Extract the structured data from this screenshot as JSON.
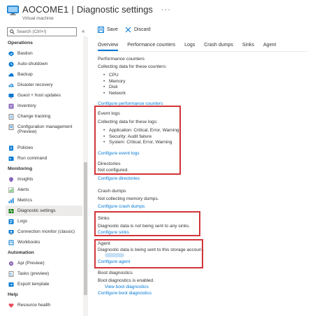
{
  "header": {
    "vm_name": "AOCOME1",
    "separator": "|",
    "title": "Diagnostic settings",
    "more": "···",
    "subtitle": "Virtual machine"
  },
  "sidebar": {
    "search_placeholder": "Search (Ctrl+/)",
    "collapse_glyph": "«",
    "sections": [
      {
        "label": "Operations",
        "items": [
          {
            "label": "Bastion",
            "icon": "bastion-icon"
          },
          {
            "label": "Auto-shutdown",
            "icon": "clock-icon"
          },
          {
            "label": "Backup",
            "icon": "backup-icon"
          },
          {
            "label": "Disaster recovery",
            "icon": "disaster-recovery-icon"
          },
          {
            "label": "Guest + host updates",
            "icon": "updates-icon"
          },
          {
            "label": "Inventory",
            "icon": "inventory-icon"
          },
          {
            "label": "Change tracking",
            "icon": "change-tracking-icon"
          },
          {
            "label": "Configuration management (Preview)",
            "icon": "config-management-icon"
          },
          {
            "label": "Policies",
            "icon": "policies-icon"
          },
          {
            "label": "Run command",
            "icon": "run-command-icon"
          }
        ]
      },
      {
        "label": "Monitoring",
        "items": [
          {
            "label": "Insights",
            "icon": "insights-icon"
          },
          {
            "label": "Alerts",
            "icon": "alerts-icon"
          },
          {
            "label": "Metrics",
            "icon": "metrics-icon"
          },
          {
            "label": "Diagnostic settings",
            "icon": "diagnostic-icon",
            "selected": true
          },
          {
            "label": "Logs",
            "icon": "logs-icon"
          },
          {
            "label": "Connection monitor (classic)",
            "icon": "connection-monitor-icon"
          },
          {
            "label": "Workbooks",
            "icon": "workbooks-icon"
          }
        ]
      },
      {
        "label": "Automation",
        "items": [
          {
            "label": "Api (Preview)",
            "icon": "api-icon"
          },
          {
            "label": "Tasks (preview)",
            "icon": "tasks-icon"
          },
          {
            "label": "Export template",
            "icon": "export-template-icon"
          }
        ]
      },
      {
        "label": "Help",
        "items": [
          {
            "label": "Resource health",
            "icon": "resource-health-icon"
          }
        ]
      }
    ]
  },
  "toolbar": {
    "save_label": "Save",
    "discard_label": "Discard"
  },
  "tabs": [
    "Overview",
    "Performance counters",
    "Logs",
    "Crash dumps",
    "Sinks",
    "Agent"
  ],
  "content": {
    "perf": {
      "heading": "Performance counters",
      "desc": "Collecting data for these counters:",
      "items": [
        "CPU",
        "Memory",
        "Disk",
        "Network"
      ],
      "link": "Configure performance counters"
    },
    "event_logs": {
      "heading": "Event logs",
      "desc": "Collecting data for these logs:",
      "items": [
        "Application: Critical, Error, Warning",
        "Security: Audit failure",
        "System: Critical, Error, Warning"
      ],
      "link": "Configure event logs"
    },
    "directories": {
      "heading": "Directories",
      "status": "Not configured.",
      "link": "Configure directories"
    },
    "crash": {
      "heading": "Crash dumps",
      "status": "Not collecting memory dumps.",
      "link": "Configure crash dumps"
    },
    "sinks": {
      "heading": "Sinks",
      "status": "Diagnostic data is not being sent to any sinks.",
      "link": "Configure sinks"
    },
    "agent": {
      "heading": "Agent",
      "status": "Diagnostic data is being sent to this storage account.",
      "link": "Configure agent"
    },
    "boot": {
      "heading": "Boot diagnostics",
      "status": "Boot diagnostics is enabled.",
      "view_link": "View boot diagnostics",
      "config_link": "Configure boot diagnostics"
    }
  },
  "colors": {
    "accent": "#0078d4",
    "highlight_box": "#d13438",
    "selected_bg": "#edebe9"
  }
}
